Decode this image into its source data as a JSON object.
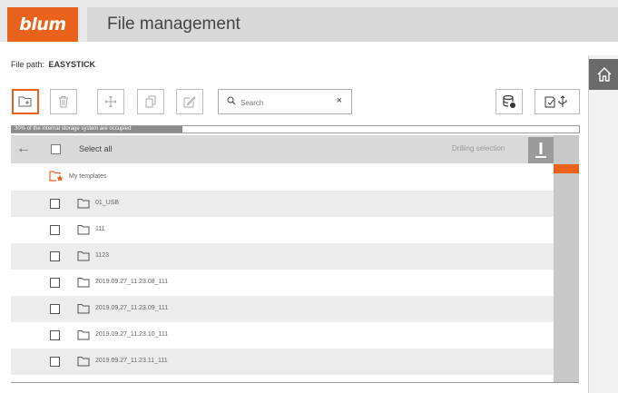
{
  "header": {
    "logo_text": "blum",
    "title": "File management"
  },
  "file_path": {
    "label": "File path:",
    "value": "EASYSTICK"
  },
  "toolbar": {
    "new_folder_icon": "new-folder-icon",
    "delete_icon": "trash-icon",
    "move_icon": "move-icon",
    "copy_icon": "copy-icon",
    "edit_icon": "edit-icon",
    "search_placeholder": "Search",
    "search_value": "",
    "clear_glyph": "×",
    "database_icon": "database-icon",
    "usb_transfer_icon": "usb-transfer-icon"
  },
  "storage": {
    "text": "30% of the internal storage system are occupied",
    "percent": 30
  },
  "list_header": {
    "back_glyph": "←",
    "select_all": "Select all",
    "drilling_selection": "Drilling selection",
    "drill_glyph": "!"
  },
  "templates_row": {
    "label": "My templates"
  },
  "folders": [
    {
      "name": "01_USB"
    },
    {
      "name": "111"
    },
    {
      "name": "1123"
    },
    {
      "name": "2019.09.27_11.23.08_111"
    },
    {
      "name": "2019.09.27_11.23.09_111"
    },
    {
      "name": "2019.09.27_11.23.10_111"
    },
    {
      "name": "2019.09.27_11.23.11_111"
    }
  ],
  "colors": {
    "accent": "#e8621c",
    "header_bg": "#e8e8e8",
    "title_bar": "#d8d8d8",
    "row_alt": "#ececec"
  }
}
